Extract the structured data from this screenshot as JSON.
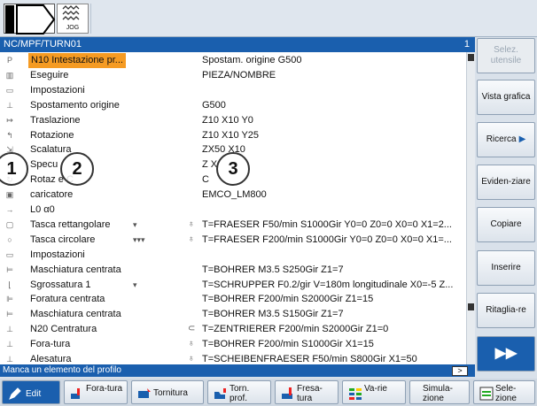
{
  "topbar": {
    "mode_label": "JOG"
  },
  "program": {
    "path": "NC/MPF/TURN01",
    "number": "1",
    "rows": [
      {
        "icon": "P",
        "name": "N10 Intestazione pr...",
        "selected": true,
        "dots": "",
        "marker": "",
        "value": "Spostam. origine G500"
      },
      {
        "icon": "▥",
        "name": "Eseguire",
        "dots": "",
        "marker": "",
        "value": "PIEZA/NOMBRE"
      },
      {
        "icon": "▭",
        "name": "Impostazioni",
        "dots": "",
        "marker": "",
        "value": ""
      },
      {
        "icon": "⊥",
        "name": "Spostamento origine",
        "dots": "",
        "marker": "",
        "value": "G500"
      },
      {
        "icon": "↦",
        "name": "Traslazione",
        "dots": "",
        "marker": "",
        "value": "Z10 X10 Y0"
      },
      {
        "icon": "↰",
        "name": "Rotazione",
        "dots": "",
        "marker": "",
        "value": "Z10 X10 Y25"
      },
      {
        "icon": "⇲",
        "name": "Scalatura",
        "dots": "",
        "marker": "",
        "value": "ZX50 X10"
      },
      {
        "icon": "▯",
        "name": "Specu",
        "dots": "",
        "marker": "",
        "value": "Z X"
      },
      {
        "icon": "↻",
        "name": "Rotaz      e C",
        "dots": "",
        "marker": "",
        "value": "C"
      },
      {
        "icon": "▣",
        "name": "caricatore",
        "dots": "",
        "marker": "",
        "value": "EMCO_LM800"
      },
      {
        "icon": "→",
        "name": "L0 α0",
        "dots": "",
        "marker": "",
        "value": ""
      },
      {
        "icon": "▢",
        "name": "Tasca rettangolare",
        "dots": "▾",
        "marker": "♁",
        "value": "T=FRAESER F50/min S1000Gir Y0=0 Z0=0 X0=0 X1=2..."
      },
      {
        "icon": "○",
        "name": "Tasca circolare",
        "dots": "▾▾▾",
        "marker": "♁",
        "value": "T=FRAESER F200/min S1000Gir Y0=0 Z0=0 X0=0 X1=..."
      },
      {
        "icon": "▭",
        "name": "Impostazioni",
        "dots": "",
        "marker": "",
        "value": ""
      },
      {
        "icon": "⊨",
        "name": "Maschiatura centrata",
        "dots": "",
        "marker": "",
        "value": "T=BOHRER M3.5 S250Gir Z1=7"
      },
      {
        "icon": "⌊",
        "name": "Sgrossatura 1",
        "dots": "▾",
        "marker": "",
        "value": "T=SCHRUPPER F0.2/gir V=180m longitudinale X0=-5 Z..."
      },
      {
        "icon": "⊫",
        "name": "Foratura centrata",
        "dots": "",
        "marker": "",
        "value": "T=BOHRER F200/min S2000Gir Z1=15"
      },
      {
        "icon": "⊨",
        "name": "Maschiatura centrata",
        "dots": "",
        "marker": "",
        "value": "T=BOHRER M3.5 S150Gir Z1=7"
      },
      {
        "icon": "⊥",
        "name": "N20 Centratura",
        "dots": "",
        "marker": "⊂",
        "value": "T=ZENTRIERER F200/min S2000Gir Z1=0"
      },
      {
        "icon": "⊥",
        "name": "Fora-tura",
        "dots": "",
        "marker": "♁",
        "value": "T=BOHRER F200/min S1000Gir X1=15"
      },
      {
        "icon": "⊥",
        "name": "Alesatura",
        "dots": "",
        "marker": "♁",
        "value": "T=SCHEIBENFRAESER F50/min S800Gir X1=50"
      }
    ]
  },
  "callouts": [
    "1",
    "2",
    "3"
  ],
  "status": {
    "text": "Manca un elemento del profilo",
    "button": ">"
  },
  "softkeys": [
    {
      "label": "Selez. utensile",
      "state": "disabled"
    },
    {
      "label": "Vista grafica",
      "state": "normal"
    },
    {
      "label": "Ricerca",
      "state": "normal",
      "arrow": "▶"
    },
    {
      "label": "Eviden-ziare",
      "state": "normal"
    },
    {
      "label": "Copiare",
      "state": "normal"
    },
    {
      "label": "Inserire",
      "state": "normal"
    },
    {
      "label": "Ritaglia-re",
      "state": "normal"
    },
    {
      "label": "▶▶",
      "state": "blue"
    }
  ],
  "bottom": [
    {
      "label": "Edit",
      "icon": "edit-icon"
    },
    {
      "label": "Fora-tura",
      "icon": "drilling-icon"
    },
    {
      "label": "Tornitura",
      "icon": "turning-icon"
    },
    {
      "label": "Torn. prof.",
      "icon": "contour-turning-icon"
    },
    {
      "label": "Fresa-tura",
      "icon": "milling-icon"
    },
    {
      "label": "Va-rie",
      "icon": "various-icon"
    },
    {
      "label": "Simula-zione",
      "icon": "simulation-icon"
    },
    {
      "label": "Sele-zione",
      "icon": "selection-icon"
    }
  ],
  "colors": {
    "header_blue": "#1a5fae",
    "selection_orange": "#f59b23"
  }
}
